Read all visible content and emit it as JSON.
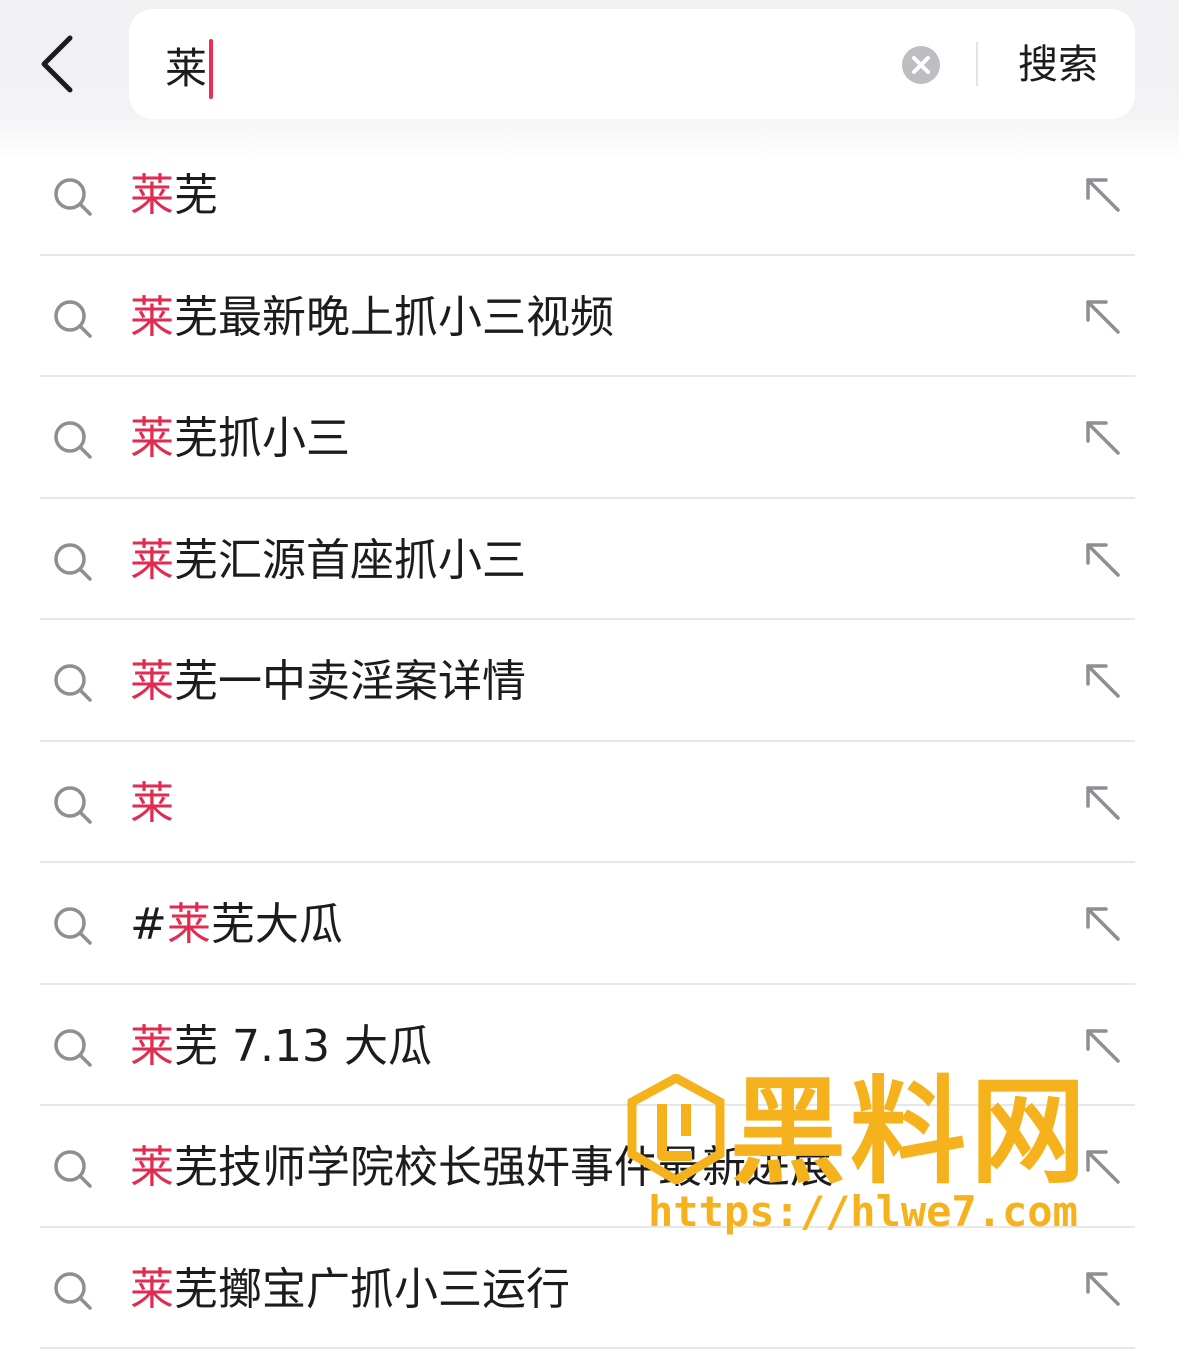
{
  "search": {
    "query": "莱",
    "search_button_label": "搜索"
  },
  "suggestions": [
    {
      "prefix": "",
      "highlight": "莱",
      "rest": "芜"
    },
    {
      "prefix": "",
      "highlight": "莱",
      "rest": "芜最新晚上抓小三视频"
    },
    {
      "prefix": "",
      "highlight": "莱",
      "rest": "芜抓小三"
    },
    {
      "prefix": "",
      "highlight": "莱",
      "rest": "芜汇源首座抓小三"
    },
    {
      "prefix": "",
      "highlight": "莱",
      "rest": "芜一中卖淫案详情"
    },
    {
      "prefix": "",
      "highlight": "莱",
      "rest": ""
    },
    {
      "prefix": "#",
      "highlight": "莱",
      "rest": "芜大瓜"
    },
    {
      "prefix": "",
      "highlight": "莱",
      "rest": "芜 7.13 大瓜"
    },
    {
      "prefix": "",
      "highlight": "莱",
      "rest": "芜技师学院校长强奸事件最新进展"
    },
    {
      "prefix": "",
      "highlight": "莱",
      "rest": "芜擲宝广抓小三运行"
    }
  ],
  "watermark": {
    "title": "黑料网",
    "url": "https://hlwe7.com"
  },
  "icons": {
    "back": "chevron-left-icon",
    "clear": "clear-circle-icon",
    "suggestion": "search-icon",
    "fill": "arrow-up-left-icon"
  },
  "colors": {
    "highlight": "#e22b50",
    "caret": "#ee2c54",
    "watermark": "#f5b21c"
  }
}
